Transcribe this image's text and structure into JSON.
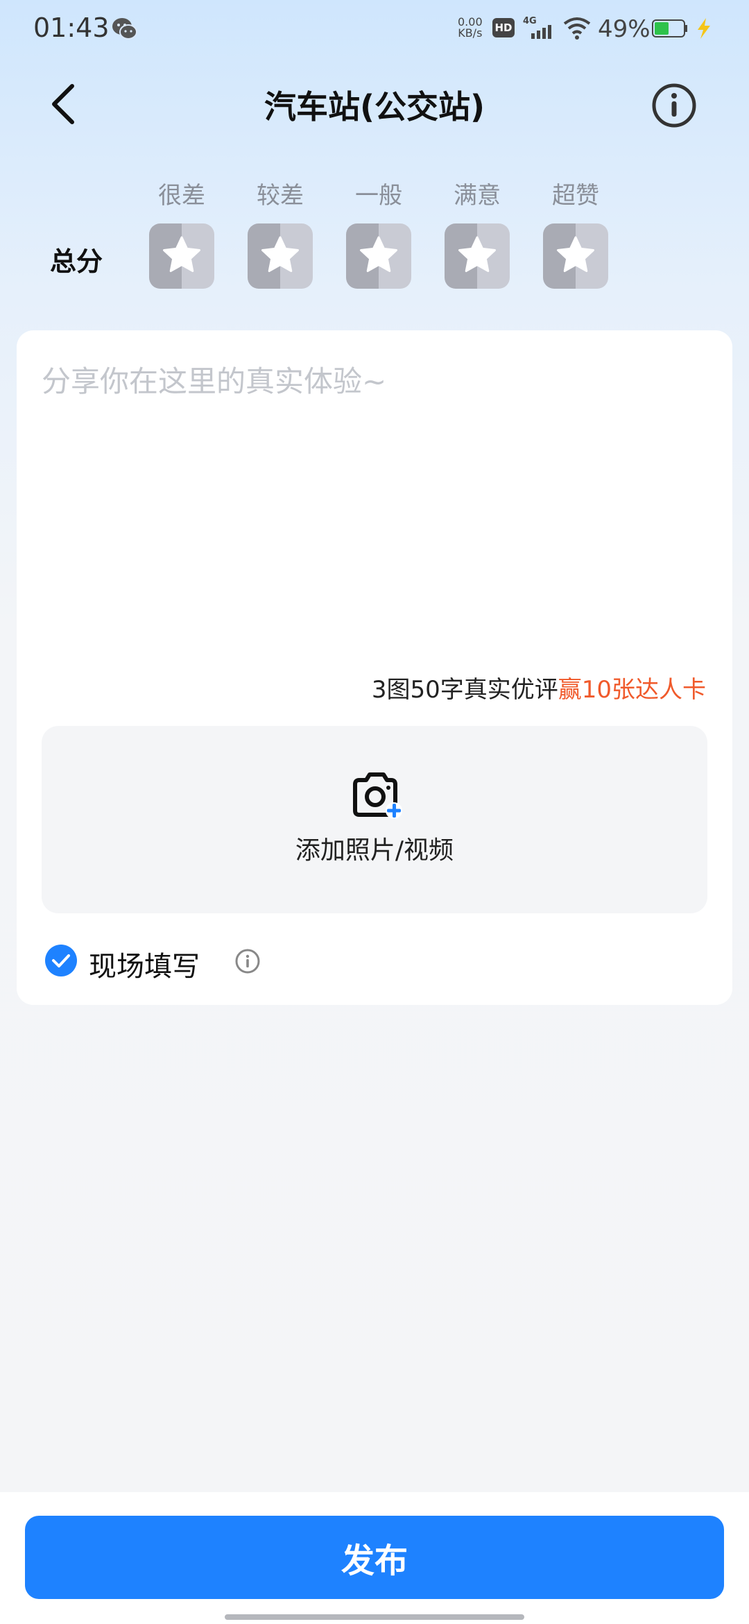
{
  "status_bar": {
    "time": "01:43",
    "net_speed": "0.00",
    "net_unit": "KB/s",
    "hd": "HD",
    "network": "4G",
    "battery_pct": "49%"
  },
  "header": {
    "title": "汽车站(公交站)"
  },
  "rating": {
    "score_label": "总分",
    "levels": [
      "很差",
      "较差",
      "一般",
      "满意",
      "超赞"
    ],
    "selected": 0
  },
  "review": {
    "placeholder": "分享你在这里的真实体验~",
    "promo_text": "3图50字真实优评",
    "promo_highlight": "赢10张达人卡"
  },
  "upload": {
    "label": "添加照片/视频"
  },
  "onsite": {
    "label": "现场填写",
    "checked": true
  },
  "footer": {
    "publish_label": "发布"
  },
  "colors": {
    "accent": "#1e82ff",
    "promo": "#f05a2b"
  }
}
